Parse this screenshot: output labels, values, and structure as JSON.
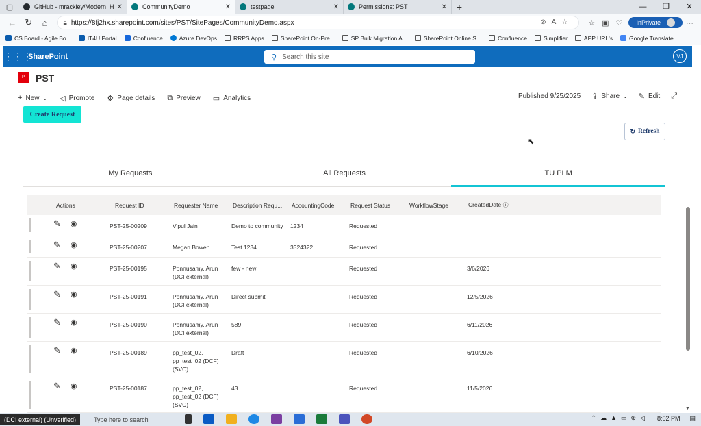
{
  "browser": {
    "tabs": [
      {
        "label": "GitHub - mrackley/Modern_Hillbi",
        "icon": "github-icon"
      },
      {
        "label": "CommunityDemo",
        "icon": "sharepoint-icon"
      },
      {
        "label": "testpage",
        "icon": "sharepoint-icon"
      },
      {
        "label": "Permissions: PST",
        "icon": "sharepoint-icon"
      }
    ],
    "url": "https://8fj2hx.sharepoint.com/sites/PST/SitePages/CommunityDemo.aspx",
    "inprivate_label": "InPrivate",
    "favorites": [
      {
        "label": "CS Board - Agile Bo...",
        "icon": "jira-icon"
      },
      {
        "label": "IT4U Portal",
        "icon": "portal-icon"
      },
      {
        "label": "Confluence",
        "icon": "confluence-icon"
      },
      {
        "label": "Azure DevOps",
        "icon": "azure-devops-icon"
      },
      {
        "label": "RRPS Apps",
        "icon": "folder-icon"
      },
      {
        "label": "SharePoint On-Pre...",
        "icon": "folder-icon"
      },
      {
        "label": "SP Bulk Migration A...",
        "icon": "folder-icon"
      },
      {
        "label": "SharePoint Online S...",
        "icon": "folder-icon"
      },
      {
        "label": "Confluence",
        "icon": "folder-icon"
      },
      {
        "label": "Simplifier",
        "icon": "folder-icon"
      },
      {
        "label": "APP URL's",
        "icon": "folder-icon"
      },
      {
        "label": "Google Translate",
        "icon": "google-translate-icon"
      }
    ]
  },
  "suite": {
    "app_name": "SharePoint",
    "search_placeholder": "Search this site",
    "user_initials": "VJ"
  },
  "site": {
    "logo_text": "P",
    "title": "PST"
  },
  "commandbar": {
    "new": "New",
    "promote": "Promote",
    "page_details": "Page details",
    "preview": "Preview",
    "analytics": "Analytics",
    "published": "Published 9/25/2025",
    "share": "Share",
    "edit": "Edit"
  },
  "page": {
    "create_request": "Create Request",
    "refresh": "Refresh",
    "tabs": [
      {
        "label": "My Requests",
        "active": false
      },
      {
        "label": "All Requests",
        "active": false
      },
      {
        "label": "TU PLM",
        "active": true
      }
    ],
    "columns": [
      "Actions",
      "Request ID",
      "Requester Name",
      "Description Requ...",
      "AccountingCode",
      "Request Status",
      "WorkflowStage",
      "CreatedDate"
    ],
    "rows": [
      {
        "id": "PST-25-00209",
        "name": [
          "Vipul Jain"
        ],
        "desc": "Demo to community",
        "acct": "1234",
        "status": "Requested",
        "stage": "",
        "date": ""
      },
      {
        "id": "PST-25-00207",
        "name": [
          "Megan Bowen"
        ],
        "desc": "Test 1234",
        "acct": "3324322",
        "status": "Requested",
        "stage": "",
        "date": ""
      },
      {
        "id": "PST-25-00195",
        "name": [
          "Ponnusamy, Arun",
          "(DCI external)"
        ],
        "desc": "few - new",
        "acct": "",
        "status": "Requested",
        "stage": "",
        "date": "3/6/2026"
      },
      {
        "id": "PST-25-00191",
        "name": [
          "Ponnusamy, Arun",
          "(DCI external)"
        ],
        "desc": "Direct submit",
        "acct": "",
        "status": "Requested",
        "stage": "",
        "date": "12/5/2026"
      },
      {
        "id": "PST-25-00190",
        "name": [
          "Ponnusamy, Arun",
          "(DCI external)"
        ],
        "desc": "589",
        "acct": "",
        "status": "Requested",
        "stage": "",
        "date": "6/11/2026"
      },
      {
        "id": "PST-25-00189",
        "name": [
          "pp_test_02,",
          "pp_test_02 (DCF)",
          "(SVC)"
        ],
        "desc": "Draft",
        "acct": "",
        "status": "Requested",
        "stage": "",
        "date": "6/10/2026"
      },
      {
        "id": "PST-25-00187",
        "name": [
          "pp_test_02,",
          "pp_test_02 (DCF)",
          "(SVC)"
        ],
        "desc": "43",
        "acct": "",
        "status": "Requested",
        "stage": "",
        "date": "11/5/2026"
      }
    ]
  },
  "taskbar": {
    "status_text": "(DCI external) (Unverified)",
    "search_text": "Type here to search",
    "time": "8:02 PM"
  }
}
